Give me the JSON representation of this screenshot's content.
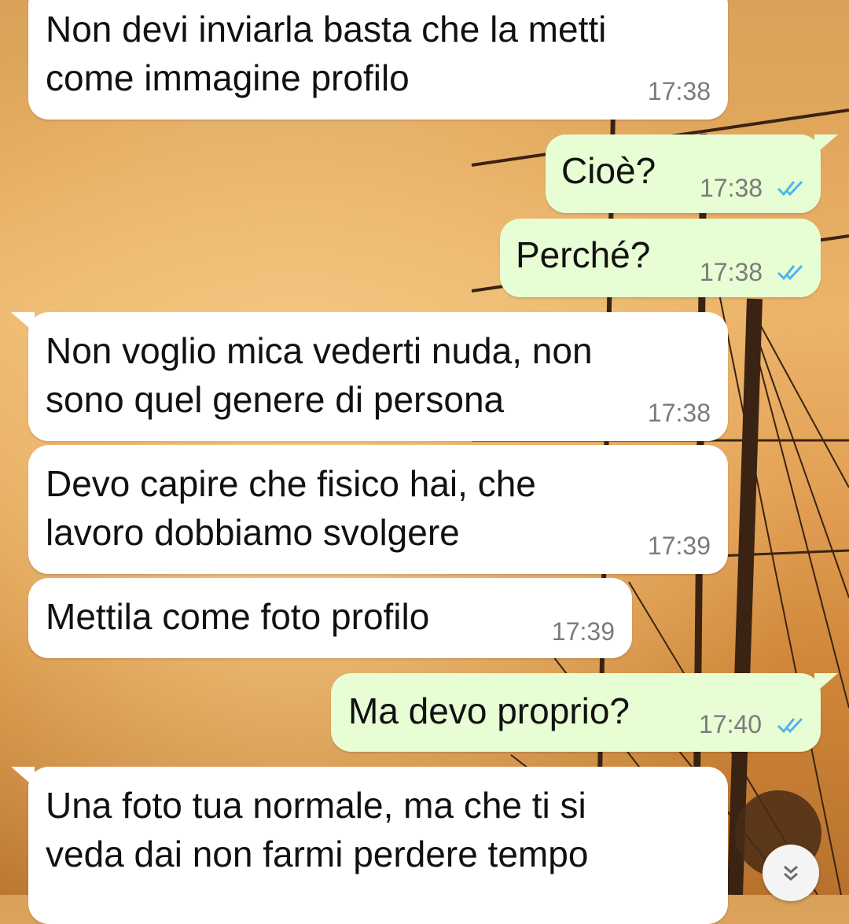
{
  "messages": [
    {
      "text": "Non devi inviarla basta che la metti\ncome immagine profilo",
      "time": "17:38",
      "direction": "in"
    },
    {
      "text": "Cioè?",
      "time": "17:38",
      "direction": "out",
      "status": "read"
    },
    {
      "text": "Perché?",
      "time": "17:38",
      "direction": "out",
      "status": "read"
    },
    {
      "text": "Non voglio mica vederti nuda, non\nsono quel genere di persona",
      "time": "17:38",
      "direction": "in"
    },
    {
      "text": "Devo capire che fisico hai, che\nlavoro dobbiamo svolgere",
      "time": "17:39",
      "direction": "in"
    },
    {
      "text": "Mettila come foto profilo",
      "time": "17:39",
      "direction": "in"
    },
    {
      "text": "Ma devo proprio?",
      "time": "17:40",
      "direction": "out",
      "status": "read"
    },
    {
      "text": "Una foto tua normale, ma che ti si\nveda dai non farmi perdere tempo",
      "time": "",
      "direction": "in"
    }
  ],
  "colors": {
    "incoming_bubble": "#ffffff",
    "outgoing_bubble": "#e7fdd3",
    "read_ticks": "#4fb6ec",
    "timestamp": "#7b7b7b"
  },
  "icons": {
    "read_receipt": "double-check-icon",
    "scroll_down": "double-chevron-down-icon"
  }
}
